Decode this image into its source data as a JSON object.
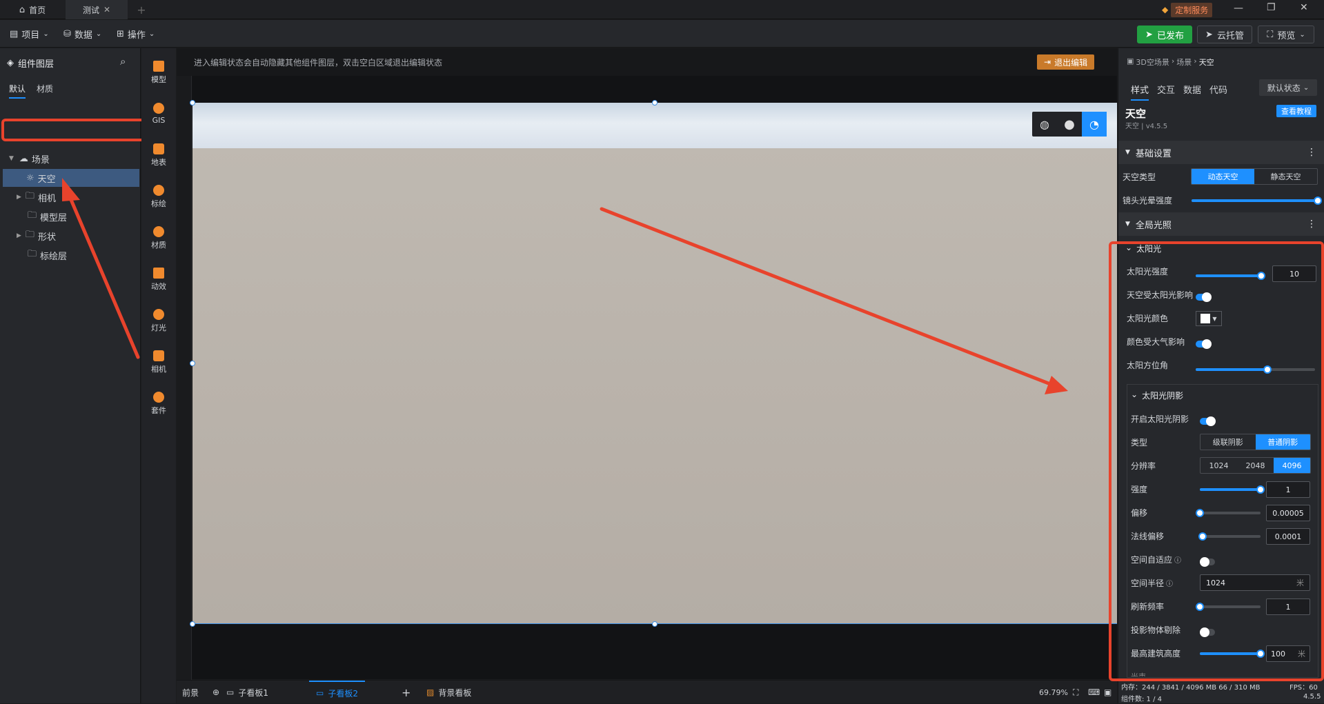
{
  "titlebar": {
    "tabs": [
      {
        "label": "首页",
        "icon": "home-icon"
      },
      {
        "label": "测试",
        "icon": "close-icon"
      }
    ],
    "add_tab": "+",
    "service_label": "定制服务"
  },
  "toolbar": {
    "menus": [
      {
        "label": "项目"
      },
      {
        "label": "数据"
      },
      {
        "label": "操作"
      }
    ],
    "publish_label": "已发布",
    "cloud_label": "云托管",
    "preview_label": "预览"
  },
  "left_panel": {
    "title": "组件图层",
    "tabs": [
      "默认",
      "材质"
    ],
    "tree": [
      {
        "label": "场景",
        "expanded": true
      },
      {
        "label": "天空",
        "selected": true
      },
      {
        "label": "相机"
      },
      {
        "label": "模型层"
      },
      {
        "label": "形状"
      },
      {
        "label": "标绘层"
      }
    ]
  },
  "icon_bar": [
    {
      "label": "模型",
      "icon": "model-icon"
    },
    {
      "label": "GIS",
      "icon": "gis-icon"
    },
    {
      "label": "地表",
      "icon": "terrain-icon"
    },
    {
      "label": "标绘",
      "icon": "marker-icon"
    },
    {
      "label": "材质",
      "icon": "material-icon"
    },
    {
      "label": "动效",
      "icon": "effect-icon"
    },
    {
      "label": "灯光",
      "icon": "light-icon"
    },
    {
      "label": "相机",
      "icon": "camera-icon"
    },
    {
      "label": "套件",
      "icon": "kit-icon"
    }
  ],
  "canvas": {
    "banner_text": "进入编辑状态会自动隐藏其他组件图层，双击空白区域退出编辑状态",
    "exit_edit_label": "退出编辑"
  },
  "bottom_bar": {
    "tabs": [
      {
        "label": "前景"
      },
      {
        "label": "子看板1"
      },
      {
        "label": "子看板2",
        "active": true
      },
      {
        "label": "背景看板"
      }
    ],
    "zoom": "69.79%"
  },
  "right_panel": {
    "breadcrumb": [
      "3D空场景",
      "场景",
      "天空"
    ],
    "tabs": [
      "样式",
      "交互",
      "数据",
      "代码"
    ],
    "state_select": "默认状态",
    "component_title": "天空",
    "component_subtitle": "天空 | v4.5.5",
    "tutorial_label": "查看教程",
    "sections": {
      "basic": "基础设置",
      "global_light": "全局光照",
      "sunlight": "太阳光",
      "sun_shadow": "太阳光阴影"
    },
    "sky_type_label": "天空类型",
    "sky_type_options": [
      "动态天空",
      "静态天空"
    ],
    "lens_flare_label": "镜头光晕强度",
    "lens_flare_value": 1.0,
    "sun_intensity_label": "太阳光强度",
    "sun_intensity_value": "10",
    "sun_intensity_level": 0.95,
    "sky_affected_label": "天空受太阳光影响",
    "sun_color_label": "太阳光颜色",
    "color_atmo_label": "颜色受大气影响",
    "sun_azimuth_label": "太阳方位角",
    "sun_azimuth_level": 0.6,
    "enable_shadow_label": "开启太阳光阴影",
    "type_label": "类型",
    "type_options": [
      "级联阴影",
      "普通阴影"
    ],
    "resolution_label": "分辨率",
    "resolution_options": [
      "1024",
      "2048",
      "4096"
    ],
    "strength_label": "强度",
    "strength_value": "1",
    "strength_level": 1.0,
    "offset_label": "偏移",
    "offset_value": "0.00005",
    "offset_level": 0.0,
    "normal_offset_label": "法线偏移",
    "normal_offset_value": "0.0001",
    "normal_offset_level": 0.05,
    "space_adapt_label": "空间自适应",
    "space_radius_label": "空间半径",
    "space_radius_value": "1024",
    "space_radius_unit": "米",
    "refresh_label": "刷新频率",
    "refresh_value": "1",
    "refresh_level": 0.0,
    "cast_remove_label": "投影物体剔除",
    "max_height_label": "最高建筑高度",
    "max_height_value": "100",
    "max_height_unit": "米",
    "collapsed_next": "光束",
    "memory_text": "内存：244 / 3841 / 4096 MB  66 / 310 MB",
    "fps_text": "FPS：60",
    "component_count": "组件数: 1 / 4",
    "version": "4.5.5"
  },
  "colors": {
    "accent": "#1e90ff",
    "annotation_red": "#e8432c",
    "publish_green": "#22a042",
    "exit_orange": "#e08a2e"
  }
}
